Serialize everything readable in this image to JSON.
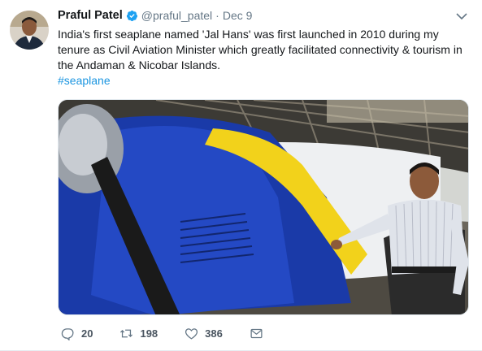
{
  "tweet": {
    "author_name": "Praful Patel",
    "handle": "@praful_patel",
    "separator": "·",
    "date": "Dec 9",
    "text": "India's first seaplane named 'Jal Hans' was first launched in 2010 during my tenure as Civil Aviation Minister which greatly facilitated connectivity & tourism in the Andaman & Nicobar Islands.",
    "hashtag": "#seaplane",
    "media_caption": "Seaplane with blue and yellow livery, man standing beside it in hangar"
  },
  "actions": {
    "replies": "20",
    "retweets": "198",
    "likes": "386"
  },
  "icons": {
    "verified": "verified-badge-icon",
    "caret": "chevron-down-icon",
    "reply": "reply-icon",
    "retweet": "retweet-icon",
    "like": "heart-icon",
    "dm": "envelope-icon"
  },
  "colors": {
    "link": "#1b95e0",
    "verified": "#1da1f2",
    "muted": "#657786"
  }
}
